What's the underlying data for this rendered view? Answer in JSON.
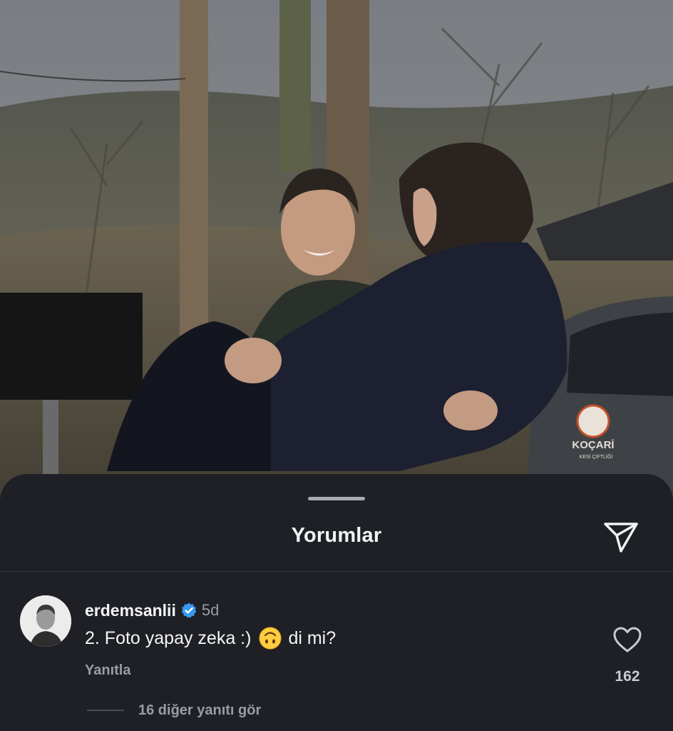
{
  "photo": {
    "logo_text": "KOÇARİ",
    "logo_subtext": "KESİ ÇİFTLİĞİ"
  },
  "sheet": {
    "title": "Yorumlar",
    "share_icon": "paper-plane-icon"
  },
  "comment": {
    "username": "erdemsanlii",
    "verified": true,
    "time": "5d",
    "text_before_emoji": "2. Foto yapay zeka :)",
    "emoji": "upside-down-face",
    "text_after_emoji": "di mi?",
    "reply_label": "Yanıtla",
    "like_icon": "heart-icon",
    "like_count": "162",
    "view_replies_label": "16 diğer yanıtı gör"
  },
  "colors": {
    "sheet_background": "#1f2026",
    "text_primary": "#f4f5f7",
    "text_secondary": "#9a9ca3",
    "verified_blue": "#3897f0"
  }
}
